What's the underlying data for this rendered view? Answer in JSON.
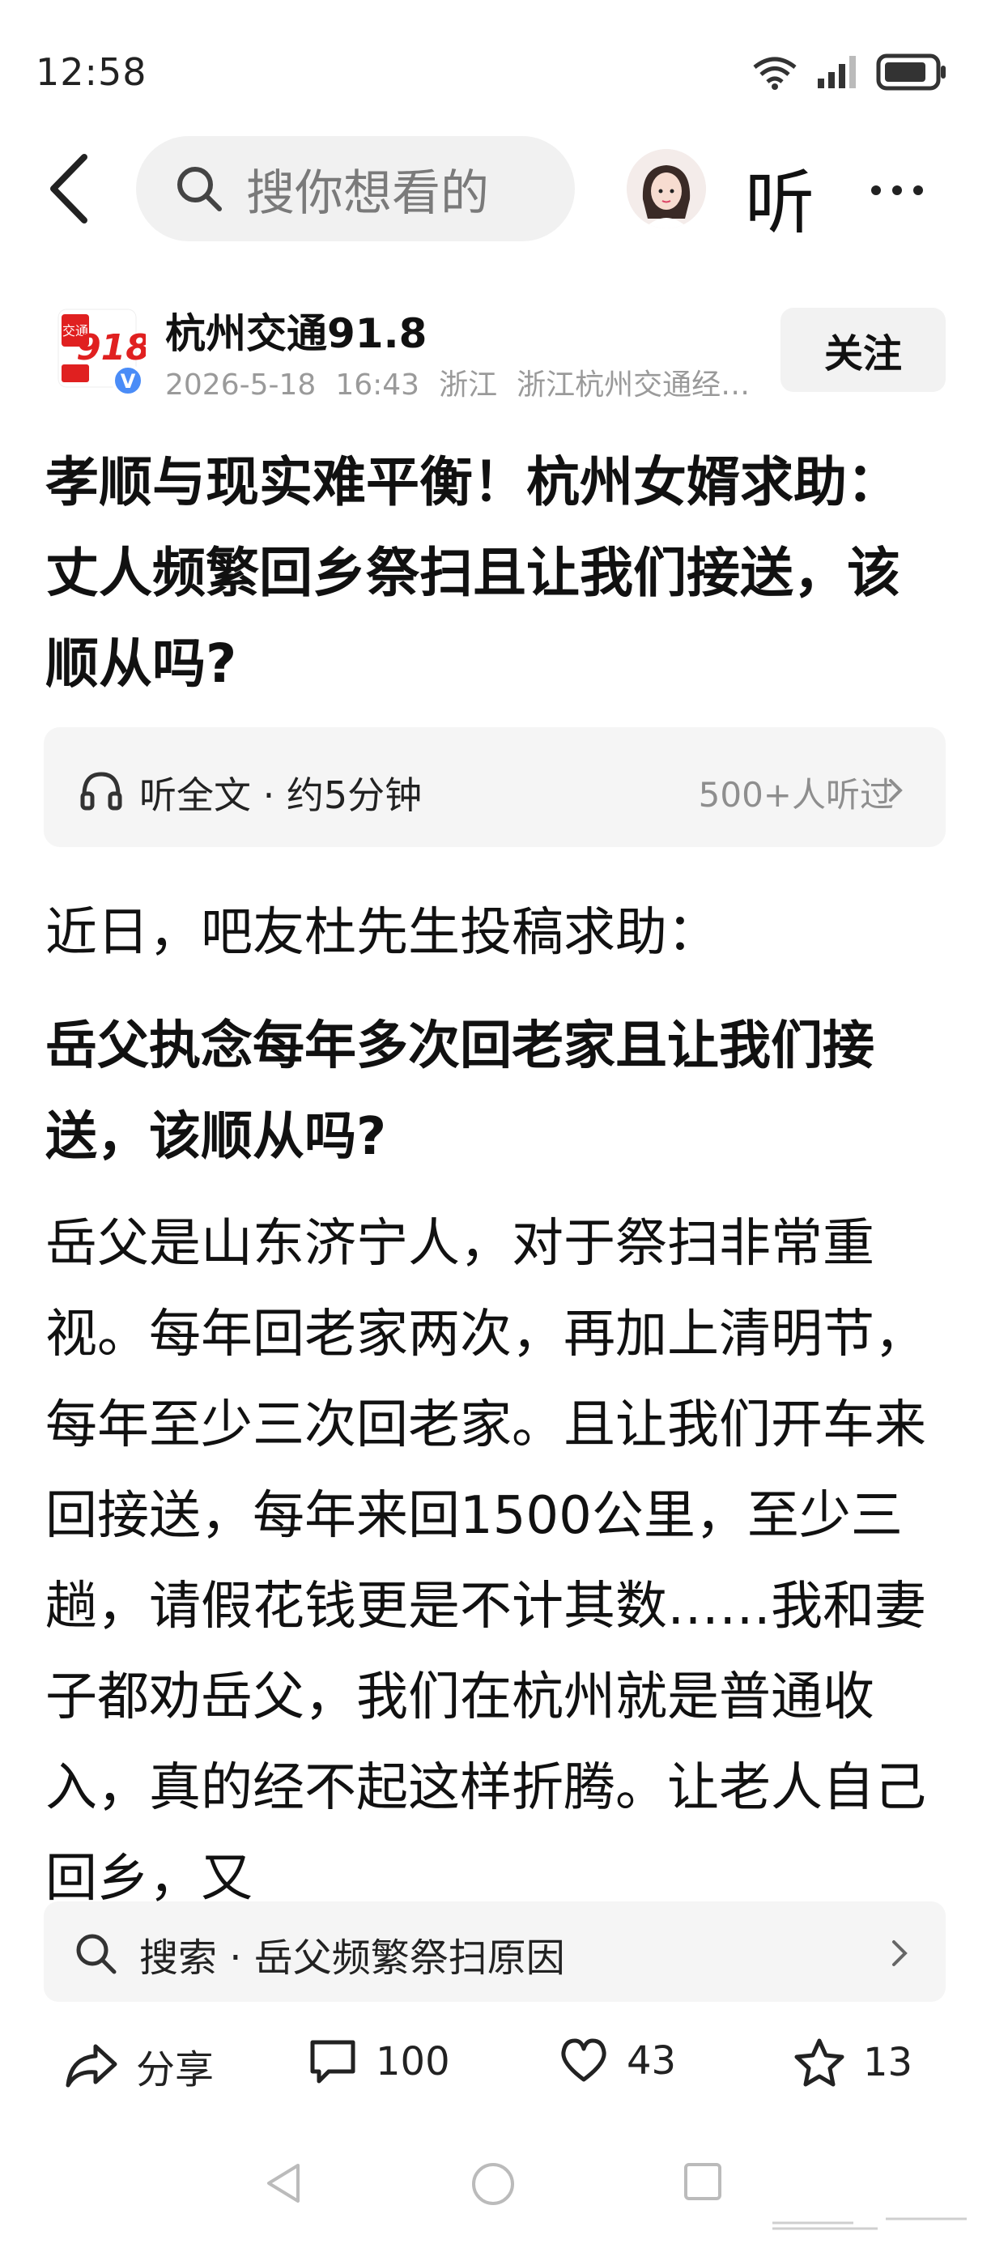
{
  "status_bar": {
    "time": "12:58",
    "battery_label": "battery-icon",
    "signal_label": "signal-icon",
    "wifi_label": "wifi-icon"
  },
  "top_nav": {
    "search_placeholder": "搜你想看的",
    "listen_label": "听"
  },
  "author": {
    "name": "杭州交通91.8",
    "date": "2026-5-18",
    "time": "16:43",
    "location": "浙江",
    "organization": "浙江杭州交通经…",
    "follow_label": "关注",
    "logo_text_top": "交通",
    "logo_text_num": "918",
    "verified": "V"
  },
  "article": {
    "title": "孝顺与现实难平衡！杭州女婿求助：丈人频繁回乡祭扫且让我们接送，该顺从吗?",
    "listen_full": "听全文 · 约5分钟",
    "listen_count": "500+人听过",
    "paragraphs": [
      "近日，吧友杜先生投稿求助：",
      "岳父执念每年多次回老家且让我们接送，该顺从吗?",
      "岳父是山东济宁人，对于祭扫非常重视。每年回老家两次，再加上清明节，每年至少三次回老家。且让我们开车来回接送，每年来回1500公里，至少三趟，请假花钱更是不计其数……我和妻子都劝岳父，我们在杭州就是普通收入，真的经不起这样折腾。让老人自己回乡，又"
    ]
  },
  "suggest": {
    "label": "搜索 · 岳父频繁祭扫原因"
  },
  "actions": {
    "share_label": "分享",
    "comment_count": "100",
    "like_count": "43",
    "favorite_count": "13"
  },
  "colors": {
    "accent_red": "#e02020",
    "text": "#111111",
    "muted": "#9a9a9a",
    "panel": "#f5f5f5"
  }
}
